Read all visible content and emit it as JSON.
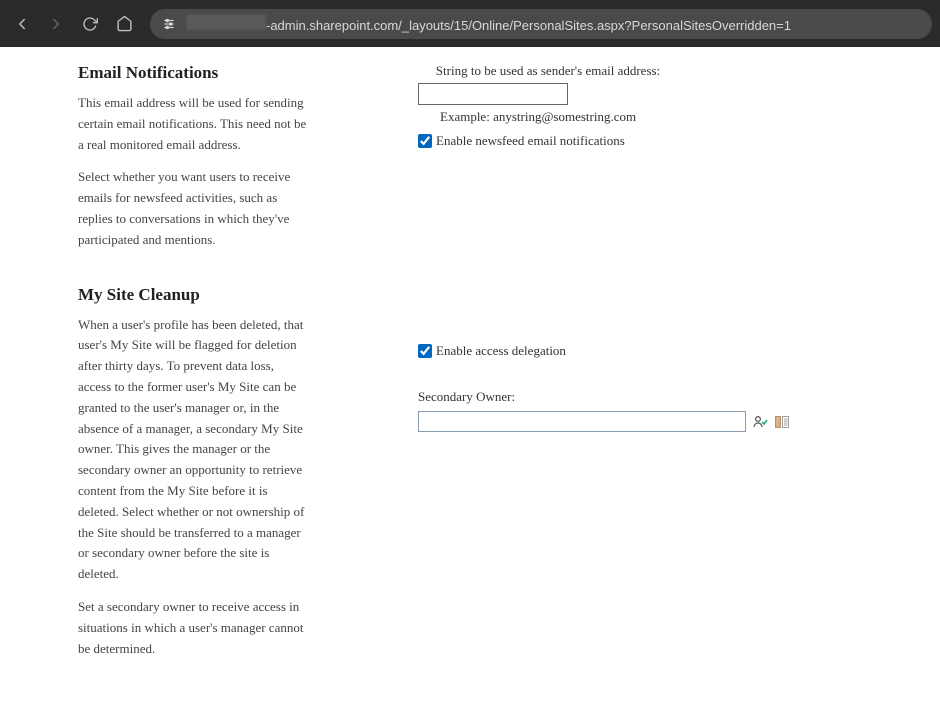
{
  "browser": {
    "url_visible": "-admin.sharepoint.com/_layouts/15/Online/PersonalSites.aspx?PersonalSitesOverridden=1"
  },
  "sections": {
    "emailNotifications": {
      "title": "Email Notifications",
      "desc1": "This email address will be used for sending certain email notifications. This need not be a real monitored email address.",
      "desc2": "Select whether you want users to receive emails for newsfeed activities, such as replies to conversations in which they've participated and mentions."
    },
    "mySiteCleanup": {
      "title": "My Site Cleanup",
      "desc1": "When a user's profile has been deleted, that user's My Site will be flagged for deletion after thirty days. To prevent data loss, access to the former user's My Site can be granted to the user's manager or, in the absence of a manager, a secondary My Site owner. This gives the manager or the secondary owner an opportunity to retrieve content from the My Site before it is deleted. Select whether or not ownership of the Site should be transferred to a manager or secondary owner before the site is deleted.",
      "desc2": "Set a secondary owner to receive access in situations in which a user's manager cannot be determined."
    }
  },
  "form": {
    "senderEmailLabel": "String to be used as sender's email address:",
    "senderEmailValue": "",
    "senderEmailExample": "Example: anystring@somestring.com",
    "enableNewsfeedLabel": "Enable newsfeed email notifications",
    "enableNewsfeedChecked": true,
    "enableAccessDelegationLabel": "Enable access delegation",
    "enableAccessDelegationChecked": true,
    "secondaryOwnerLabel": "Secondary Owner:",
    "secondaryOwnerValue": ""
  }
}
